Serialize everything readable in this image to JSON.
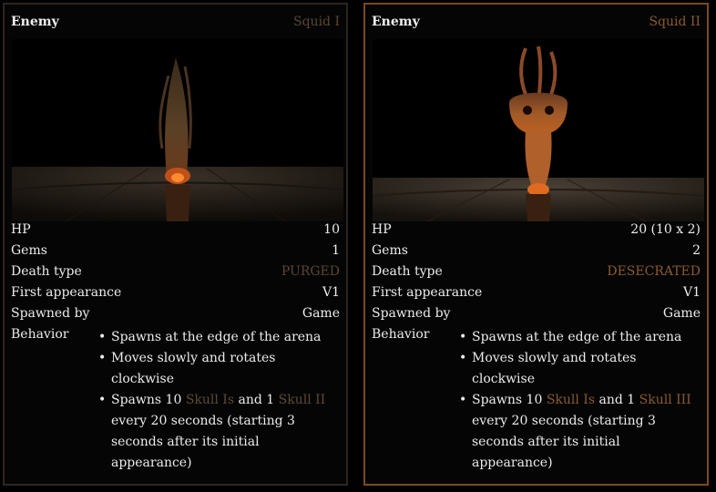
{
  "cards": [
    {
      "header_tag": "Enemy",
      "name": "Squid I",
      "name_color": "#5b4632",
      "hp_label": "HP",
      "hp": "10",
      "gems_label": "Gems",
      "gems": "1",
      "death_label": "Death type",
      "death": "PURGED",
      "death_color": "#5b4632",
      "first_label": "First appearance",
      "first": "V1",
      "spawned_label": "Spawned by",
      "spawned": "Game",
      "behavior_label": "Behavior",
      "behaviors": [
        "Spawns at the edge of the arena",
        "Moves slowly and rotates clockwise",
        "Spawns 10 ",
        "Skull Is",
        " and 1 ",
        "Skull II",
        " every 20 seconds (starting 3 seconds after its initial appearance)"
      ]
    },
    {
      "header_tag": "Enemy",
      "name": "Squid II",
      "name_color": "#8c5a30",
      "hp_label": "HP",
      "hp": "20 (10 x 2)",
      "gems_label": "Gems",
      "gems": "2",
      "death_label": "Death type",
      "death": "DESECRATED",
      "death_color": "#8c5a30",
      "first_label": "First appearance",
      "first": "V1",
      "spawned_label": "Spawned by",
      "spawned": "Game",
      "behavior_label": "Behavior",
      "behaviors": [
        "Spawns at the edge of the arena",
        "Moves slowly and rotates clockwise",
        "Spawns 10 ",
        "Skull Is",
        " and 1 ",
        "Skull III",
        " every 20 seconds (starting 3 seconds after its initial appearance)"
      ]
    }
  ]
}
